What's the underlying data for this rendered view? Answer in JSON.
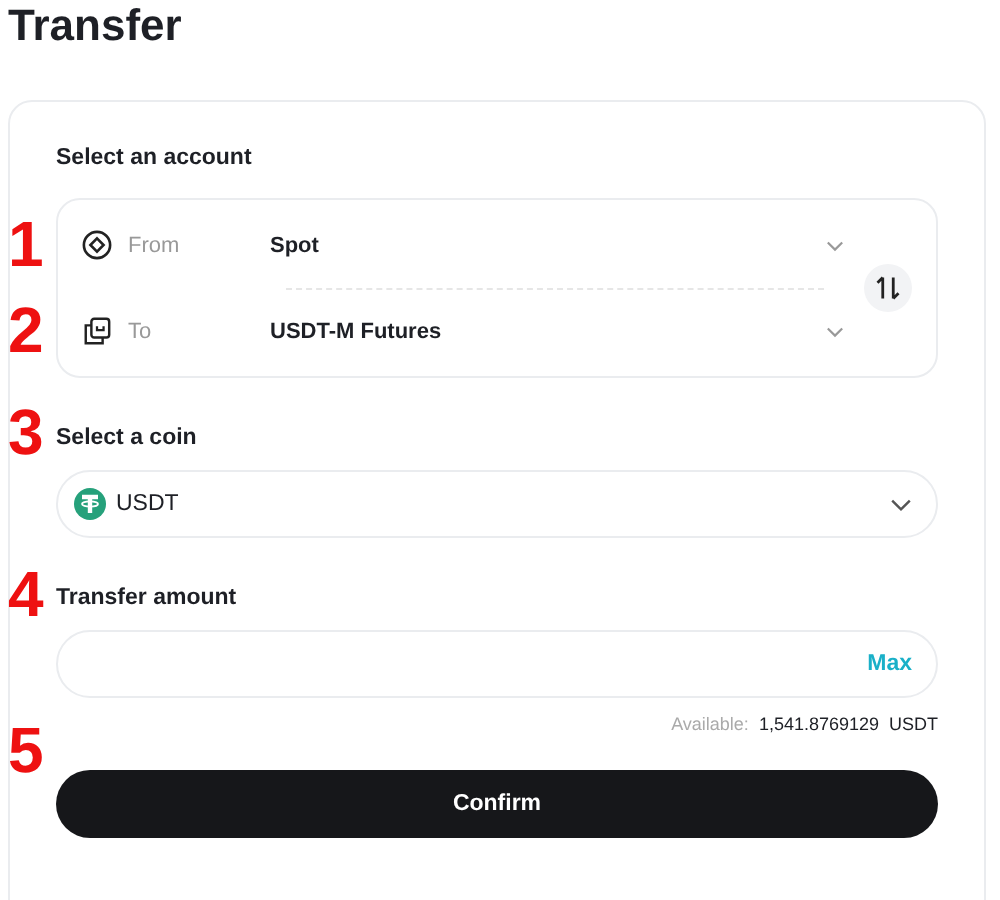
{
  "page_title": "Transfer",
  "account": {
    "label": "Select an account",
    "rows": [
      {
        "marker": "1",
        "kind": "from",
        "label": "From",
        "value": "Spot"
      },
      {
        "marker": "2",
        "kind": "to",
        "label": "To",
        "value": "USDT-M Futures"
      }
    ]
  },
  "coin": {
    "marker": "3",
    "label": "Select a coin",
    "value": "USDT"
  },
  "amount": {
    "marker": "4",
    "label": "Transfer amount",
    "action": "Max",
    "available_label": "Available:",
    "available_value": "1,541.8769129",
    "available_unit": "USDT"
  },
  "confirm": {
    "marker": "5",
    "label": "Confirm"
  }
}
